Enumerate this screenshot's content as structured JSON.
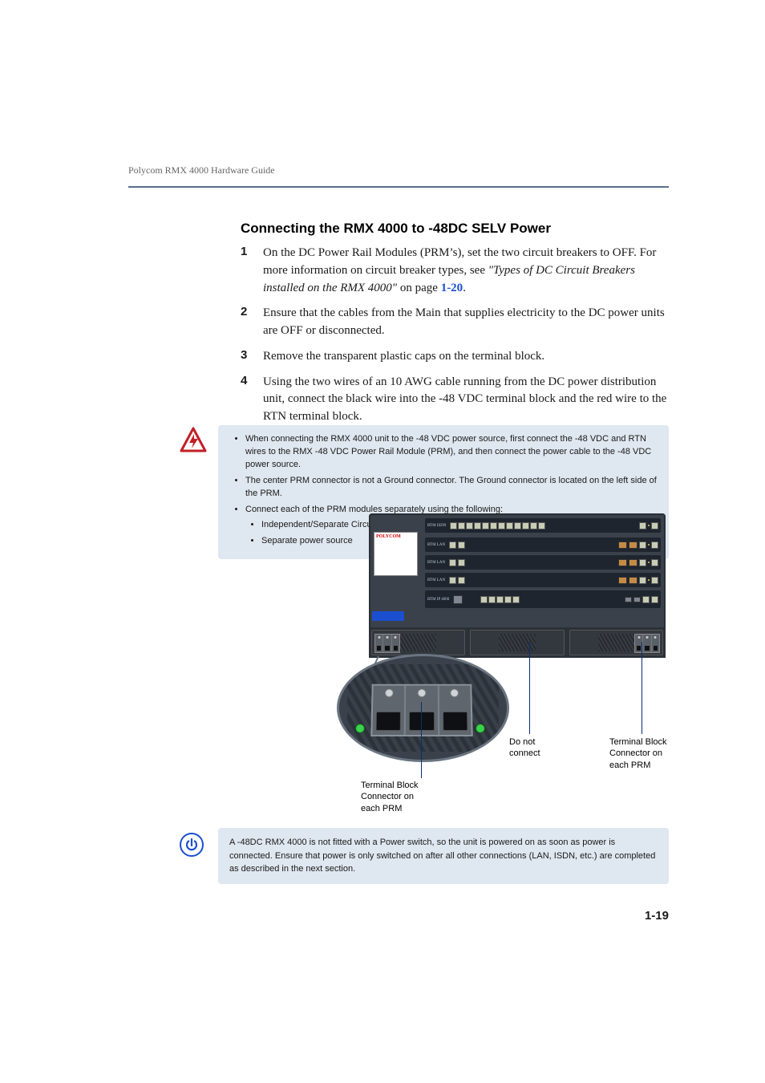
{
  "running_head": "Polycom RMX 4000 Hardware Guide",
  "section_heading": "Connecting the RMX 4000 to -48DC SELV Power",
  "steps": [
    {
      "num": "1",
      "pre": "On the DC Power Rail Modules (PRM’s), set the two circuit breakers to OFF. For more information on circuit breaker types, see ",
      "ital": "\"Types of DC Circuit Breakers installed on the RMX 4000\"",
      "post": " on page ",
      "link": "1-20",
      "tail": "."
    },
    {
      "num": "2",
      "text": "Ensure that the cables from the Main that supplies electricity to the DC power units are OFF or disconnected."
    },
    {
      "num": "3",
      "text": "Remove the transparent plastic caps on the terminal block."
    },
    {
      "num": "4",
      "text": "Using the two wires of an 10 AWG cable running from the DC power distribution unit, connect the black wire into the -48 VDC terminal block and the red wire to the RTN terminal block."
    }
  ],
  "warning": {
    "bullets": [
      "When connecting the RMX 4000 unit to the -48 VDC power source, first connect the -48 VDC and RTN wires to the RMX -48 VDC Power Rail Module (PRM), and then connect the power cable to the -48 VDC power source.",
      "The center PRM connector is not a Ground connector. The Ground connector is located on the left side of the PRM.",
      "Connect each of the PRM modules separately using the following:",
      "Independent/Separate Circuit breakers",
      "Separate power source"
    ]
  },
  "figure": {
    "poly_brand": "POLYCOM",
    "rows": {
      "top_label": "RTM ISDN",
      "lan_label": "RTM LAN",
      "ip_label": "RTM IP 4000"
    },
    "callouts": {
      "mid": "Do not\nconnect",
      "left": "Terminal Block\nConnector on\neach PRM",
      "right": "Terminal Block\nConnector on\neach PRM"
    }
  },
  "note": "A -48DC RMX 4000 is not fitted with a Power switch, so the unit is powered on as soon as power is connected. Ensure that power is only switched on after all other connections (LAN, ISDN, etc.) are completed as described in the next section.",
  "page_number": "1-19"
}
